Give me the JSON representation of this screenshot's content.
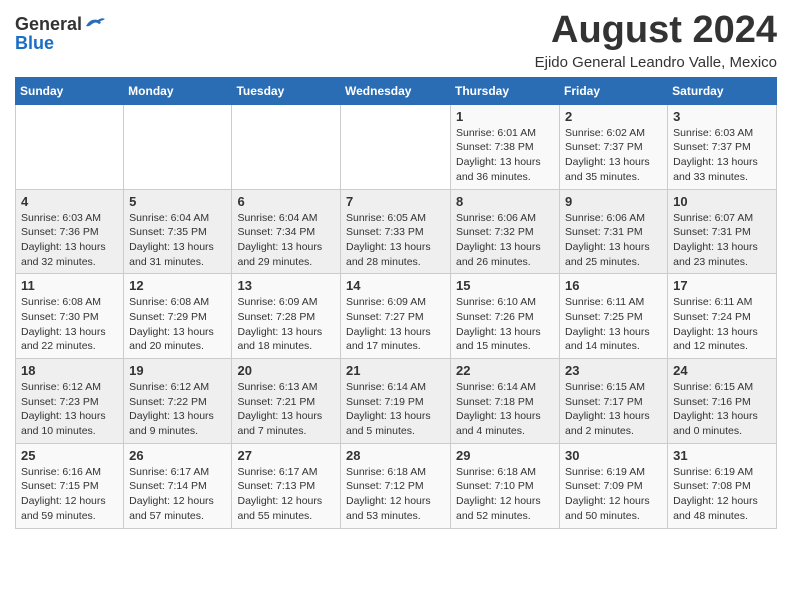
{
  "header": {
    "logo_general": "General",
    "logo_blue": "Blue",
    "month_title": "August 2024",
    "location": "Ejido General Leandro Valle, Mexico"
  },
  "weekdays": [
    "Sunday",
    "Monday",
    "Tuesday",
    "Wednesday",
    "Thursday",
    "Friday",
    "Saturday"
  ],
  "weeks": [
    [
      {
        "day": "",
        "detail": ""
      },
      {
        "day": "",
        "detail": ""
      },
      {
        "day": "",
        "detail": ""
      },
      {
        "day": "",
        "detail": ""
      },
      {
        "day": "1",
        "detail": "Sunrise: 6:01 AM\nSunset: 7:38 PM\nDaylight: 13 hours\nand 36 minutes."
      },
      {
        "day": "2",
        "detail": "Sunrise: 6:02 AM\nSunset: 7:37 PM\nDaylight: 13 hours\nand 35 minutes."
      },
      {
        "day": "3",
        "detail": "Sunrise: 6:03 AM\nSunset: 7:37 PM\nDaylight: 13 hours\nand 33 minutes."
      }
    ],
    [
      {
        "day": "4",
        "detail": "Sunrise: 6:03 AM\nSunset: 7:36 PM\nDaylight: 13 hours\nand 32 minutes."
      },
      {
        "day": "5",
        "detail": "Sunrise: 6:04 AM\nSunset: 7:35 PM\nDaylight: 13 hours\nand 31 minutes."
      },
      {
        "day": "6",
        "detail": "Sunrise: 6:04 AM\nSunset: 7:34 PM\nDaylight: 13 hours\nand 29 minutes."
      },
      {
        "day": "7",
        "detail": "Sunrise: 6:05 AM\nSunset: 7:33 PM\nDaylight: 13 hours\nand 28 minutes."
      },
      {
        "day": "8",
        "detail": "Sunrise: 6:06 AM\nSunset: 7:32 PM\nDaylight: 13 hours\nand 26 minutes."
      },
      {
        "day": "9",
        "detail": "Sunrise: 6:06 AM\nSunset: 7:31 PM\nDaylight: 13 hours\nand 25 minutes."
      },
      {
        "day": "10",
        "detail": "Sunrise: 6:07 AM\nSunset: 7:31 PM\nDaylight: 13 hours\nand 23 minutes."
      }
    ],
    [
      {
        "day": "11",
        "detail": "Sunrise: 6:08 AM\nSunset: 7:30 PM\nDaylight: 13 hours\nand 22 minutes."
      },
      {
        "day": "12",
        "detail": "Sunrise: 6:08 AM\nSunset: 7:29 PM\nDaylight: 13 hours\nand 20 minutes."
      },
      {
        "day": "13",
        "detail": "Sunrise: 6:09 AM\nSunset: 7:28 PM\nDaylight: 13 hours\nand 18 minutes."
      },
      {
        "day": "14",
        "detail": "Sunrise: 6:09 AM\nSunset: 7:27 PM\nDaylight: 13 hours\nand 17 minutes."
      },
      {
        "day": "15",
        "detail": "Sunrise: 6:10 AM\nSunset: 7:26 PM\nDaylight: 13 hours\nand 15 minutes."
      },
      {
        "day": "16",
        "detail": "Sunrise: 6:11 AM\nSunset: 7:25 PM\nDaylight: 13 hours\nand 14 minutes."
      },
      {
        "day": "17",
        "detail": "Sunrise: 6:11 AM\nSunset: 7:24 PM\nDaylight: 13 hours\nand 12 minutes."
      }
    ],
    [
      {
        "day": "18",
        "detail": "Sunrise: 6:12 AM\nSunset: 7:23 PM\nDaylight: 13 hours\nand 10 minutes."
      },
      {
        "day": "19",
        "detail": "Sunrise: 6:12 AM\nSunset: 7:22 PM\nDaylight: 13 hours\nand 9 minutes."
      },
      {
        "day": "20",
        "detail": "Sunrise: 6:13 AM\nSunset: 7:21 PM\nDaylight: 13 hours\nand 7 minutes."
      },
      {
        "day": "21",
        "detail": "Sunrise: 6:14 AM\nSunset: 7:19 PM\nDaylight: 13 hours\nand 5 minutes."
      },
      {
        "day": "22",
        "detail": "Sunrise: 6:14 AM\nSunset: 7:18 PM\nDaylight: 13 hours\nand 4 minutes."
      },
      {
        "day": "23",
        "detail": "Sunrise: 6:15 AM\nSunset: 7:17 PM\nDaylight: 13 hours\nand 2 minutes."
      },
      {
        "day": "24",
        "detail": "Sunrise: 6:15 AM\nSunset: 7:16 PM\nDaylight: 13 hours\nand 0 minutes."
      }
    ],
    [
      {
        "day": "25",
        "detail": "Sunrise: 6:16 AM\nSunset: 7:15 PM\nDaylight: 12 hours\nand 59 minutes."
      },
      {
        "day": "26",
        "detail": "Sunrise: 6:17 AM\nSunset: 7:14 PM\nDaylight: 12 hours\nand 57 minutes."
      },
      {
        "day": "27",
        "detail": "Sunrise: 6:17 AM\nSunset: 7:13 PM\nDaylight: 12 hours\nand 55 minutes."
      },
      {
        "day": "28",
        "detail": "Sunrise: 6:18 AM\nSunset: 7:12 PM\nDaylight: 12 hours\nand 53 minutes."
      },
      {
        "day": "29",
        "detail": "Sunrise: 6:18 AM\nSunset: 7:10 PM\nDaylight: 12 hours\nand 52 minutes."
      },
      {
        "day": "30",
        "detail": "Sunrise: 6:19 AM\nSunset: 7:09 PM\nDaylight: 12 hours\nand 50 minutes."
      },
      {
        "day": "31",
        "detail": "Sunrise: 6:19 AM\nSunset: 7:08 PM\nDaylight: 12 hours\nand 48 minutes."
      }
    ]
  ]
}
